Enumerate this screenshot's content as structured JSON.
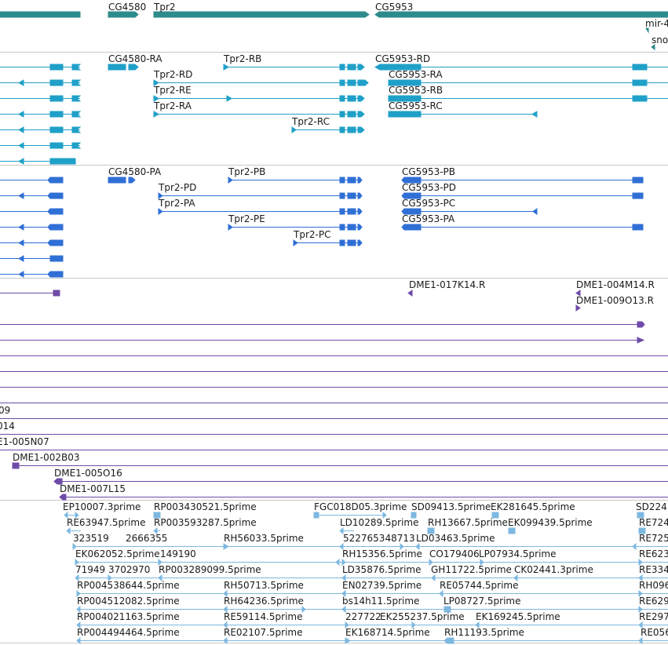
{
  "colors": {
    "gene": "#2E8B8B",
    "mrna": "#1FA0C8",
    "cds": "#2F6FD6",
    "clone": "#6E4BA8",
    "est": "#7DB8E0",
    "divider": "#C8C8C8"
  },
  "tracks": {
    "genes": {
      "labels": [
        {
          "text": "CG4580"
        },
        {
          "text": "Tpr2"
        },
        {
          "text": "CG5953"
        },
        {
          "text": "mir-4"
        },
        {
          "text": "sno"
        }
      ]
    },
    "transcripts": {
      "labels": [
        {
          "text": "CG4580-RA"
        },
        {
          "text": "Tpr2-RB"
        },
        {
          "text": "CG5953-RD"
        },
        {
          "text": "Tpr2-RD"
        },
        {
          "text": "CG5953-RA"
        },
        {
          "text": "Tpr2-RE"
        },
        {
          "text": "CG5953-RB"
        },
        {
          "text": "Tpr2-RA"
        },
        {
          "text": "CG5953-RC"
        },
        {
          "text": "Tpr2-RC"
        }
      ]
    },
    "proteins": {
      "labels": [
        {
          "text": "CG4580-PA"
        },
        {
          "text": "Tpr2-PB"
        },
        {
          "text": "CG5953-PB"
        },
        {
          "text": "Tpr2-PD"
        },
        {
          "text": "CG5953-PD"
        },
        {
          "text": "Tpr2-PA"
        },
        {
          "text": "CG5953-PC"
        },
        {
          "text": "Tpr2-PE"
        },
        {
          "text": "CG5953-PA"
        },
        {
          "text": "Tpr2-PC"
        }
      ]
    },
    "clones": {
      "labels": [
        {
          "text": "DME1-017K14.R"
        },
        {
          "text": "DME1-004M14.R"
        },
        {
          "text": "DME1-009O13.R"
        },
        {
          "text": "09"
        },
        {
          "text": "014"
        },
        {
          "text": "E1-005N07"
        },
        {
          "text": "DME1-002B03"
        },
        {
          "text": "DME1-005O16"
        },
        {
          "text": "DME1-007L15"
        }
      ]
    },
    "ests": {
      "labels": [
        {
          "text": "EP10007.3prime"
        },
        {
          "text": "RP003430521.5prime"
        },
        {
          "text": "FGC018D05.3prime"
        },
        {
          "text": "SD09413.5prime"
        },
        {
          "text": "EK281645.5prime"
        },
        {
          "text": "SD224"
        },
        {
          "text": "RE63947.5prime"
        },
        {
          "text": "RP003593287.5prime"
        },
        {
          "text": "LD10289.5prime"
        },
        {
          "text": "RH13667.5prime"
        },
        {
          "text": "EK099439.5prime"
        },
        {
          "text": "RE724"
        },
        {
          "text": "323519"
        },
        {
          "text": "2666355"
        },
        {
          "text": "RH56033.5prime"
        },
        {
          "text": "522765348713"
        },
        {
          "text": "LD03463.5prime"
        },
        {
          "text": "RE725"
        },
        {
          "text": "EK062052.5prime"
        },
        {
          "text": "149190"
        },
        {
          "text": "RH15356.5prime"
        },
        {
          "text": "CO179406"
        },
        {
          "text": "LP07934.5prime"
        },
        {
          "text": "RE623"
        },
        {
          "text": "71949"
        },
        {
          "text": "3702970"
        },
        {
          "text": "RP003289099.5prime"
        },
        {
          "text": "LD35876.5prime"
        },
        {
          "text": "GH11722.5prime"
        },
        {
          "text": "CK02441.3prime"
        },
        {
          "text": "RE334"
        },
        {
          "text": "RP004538644.5prime"
        },
        {
          "text": "RH50713.5prime"
        },
        {
          "text": "EN02739.5prime"
        },
        {
          "text": "RE05744.5prime"
        },
        {
          "text": "RH096"
        },
        {
          "text": "RP004512082.5prime"
        },
        {
          "text": "RH64236.5prime"
        },
        {
          "text": "bs14h11.5prime"
        },
        {
          "text": "LP08727.5prime"
        },
        {
          "text": "RE629"
        },
        {
          "text": "RP004021163.5prime"
        },
        {
          "text": "RE59114.5prime"
        },
        {
          "text": "227722"
        },
        {
          "text": "EK255237.5prime"
        },
        {
          "text": "EK169245.5prime"
        },
        {
          "text": "RE297"
        },
        {
          "text": "RP004494464.5prime"
        },
        {
          "text": "RE02107.5prime"
        },
        {
          "text": "EK168714.5prime"
        },
        {
          "text": "RH11193.5prime"
        },
        {
          "text": "RE056"
        }
      ]
    }
  }
}
